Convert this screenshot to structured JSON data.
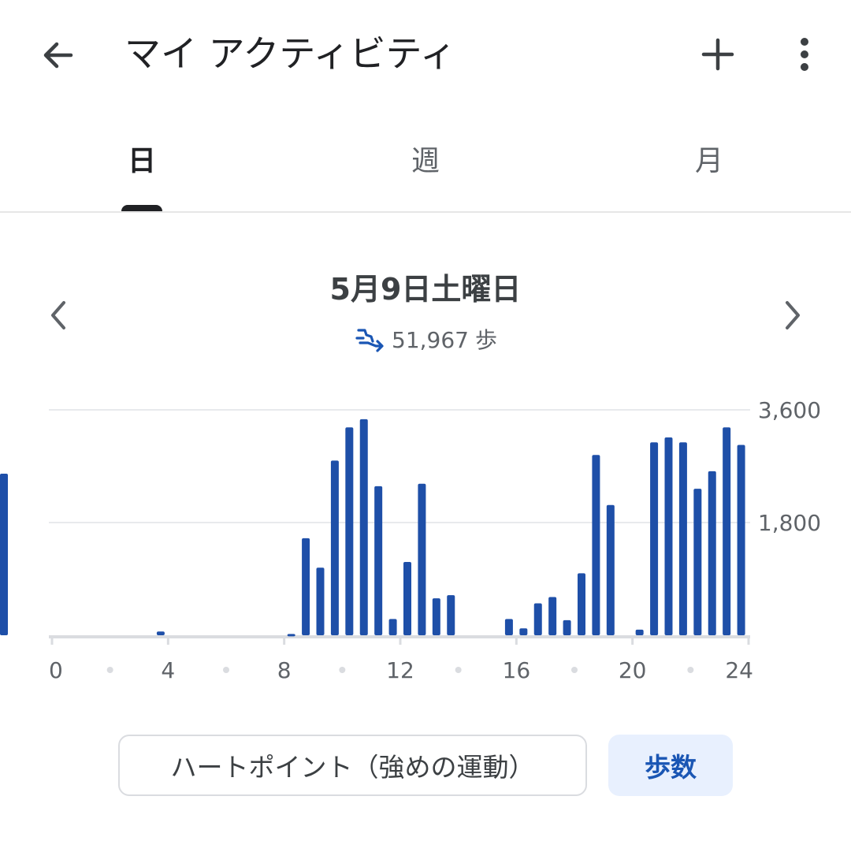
{
  "appbar": {
    "title": "マイ アクティビティ"
  },
  "tabs": [
    {
      "label": "日",
      "active": true
    },
    {
      "label": "週",
      "active": false
    },
    {
      "label": "月",
      "active": false
    }
  ],
  "day": {
    "date": "5月9日土曜日",
    "total_steps": "51,967",
    "unit": "歩"
  },
  "chips": {
    "heart": "ハートポイント（強めの運動）",
    "steps": "歩数"
  },
  "colors": {
    "bar": "#1e4fa8",
    "accent": "#1a56b4",
    "grid": "#e8eaed"
  },
  "chart_data": {
    "type": "bar",
    "x_unit": "hour",
    "x": [
      0,
      0.5,
      1,
      1.5,
      2,
      2.5,
      3,
      3.5,
      4,
      4.5,
      5,
      5.5,
      6,
      6.5,
      7,
      7.5,
      8,
      8.5,
      9,
      9.5,
      10,
      10.5,
      11,
      11.5,
      12,
      12.5,
      13,
      13.5,
      14,
      14.5,
      15,
      15.5,
      16,
      16.5,
      17,
      17.5,
      18,
      18.5,
      19,
      19.5,
      20,
      20.5,
      21,
      21.5,
      22,
      22.5,
      23,
      23.5
    ],
    "values": [
      0,
      0,
      0,
      0,
      0,
      0,
      0,
      60,
      0,
      0,
      0,
      0,
      0,
      0,
      0,
      0,
      20,
      1550,
      1080,
      2790,
      3320,
      3450,
      2380,
      260,
      1170,
      2420,
      590,
      640,
      0,
      0,
      0,
      260,
      110,
      510,
      610,
      240,
      990,
      2880,
      2080,
      0,
      90,
      3080,
      3160,
      3080,
      2340,
      2620,
      3320,
      3040,
      2580
    ],
    "yticks": [
      "3,600",
      "1,800"
    ],
    "ytick_values": [
      3600,
      1800
    ],
    "xticks": [
      "0",
      "4",
      "8",
      "12",
      "16",
      "20",
      "24"
    ],
    "xtick_values": [
      0,
      4,
      8,
      12,
      16,
      20,
      24
    ],
    "ylim": [
      0,
      3600
    ],
    "xlim": [
      0,
      24
    ],
    "grid": true
  }
}
